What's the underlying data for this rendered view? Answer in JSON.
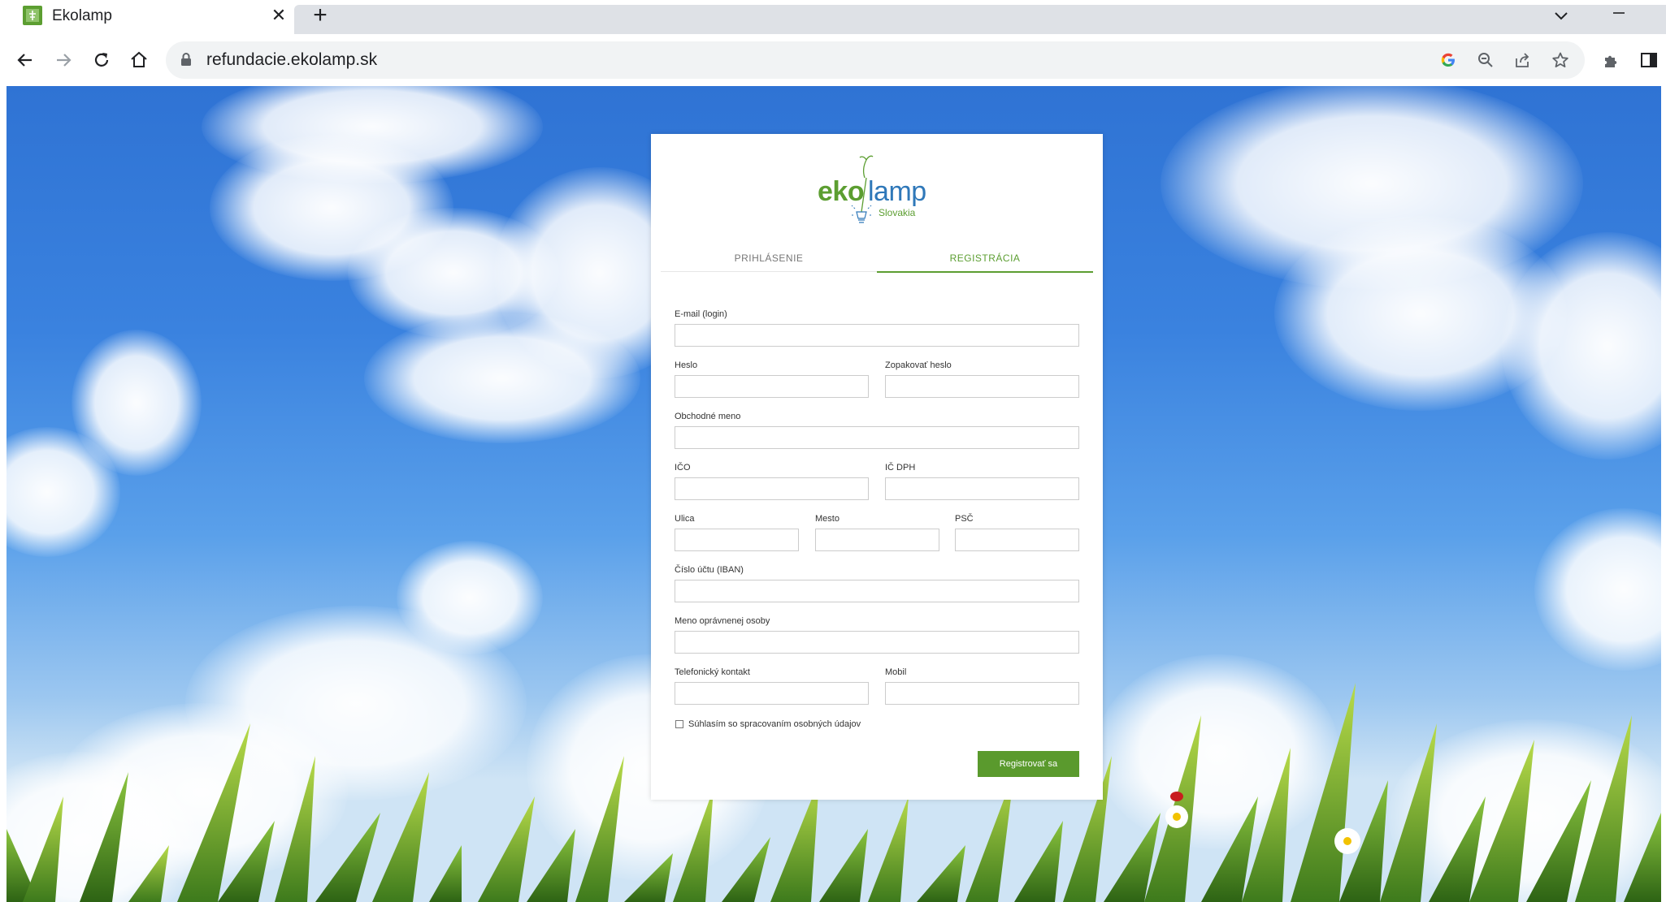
{
  "browser": {
    "tab_title": "Ekolamp",
    "tab_close": "✕",
    "new_tab": "+",
    "url": "refundacie.ekolamp.sk"
  },
  "icons": {
    "back": "arrow-left-icon",
    "forward": "arrow-right-icon",
    "reload": "reload-icon",
    "home": "home-icon",
    "lock": "lock-icon",
    "google": "google-icon",
    "zoom": "zoom-out-icon",
    "share": "share-icon",
    "bookmark": "star-icon",
    "extensions": "puzzle-icon",
    "sidepanel": "side-panel-icon"
  },
  "logo": {
    "eko": "eko",
    "lamp": "lamp",
    "sub": "Slovakia"
  },
  "tabs": {
    "login": "PRIHLÁSENIE",
    "register": "REGISTRÁCIA"
  },
  "form": {
    "email": {
      "label": "E-mail (login)",
      "value": ""
    },
    "password": {
      "label": "Heslo",
      "value": ""
    },
    "password_repeat": {
      "label": "Zopakovať heslo",
      "value": ""
    },
    "business_name": {
      "label": "Obchodné meno",
      "value": ""
    },
    "ico": {
      "label": "IČO",
      "value": ""
    },
    "ic_dph": {
      "label": "IČ DPH",
      "value": ""
    },
    "street": {
      "label": "Ulica",
      "value": ""
    },
    "city": {
      "label": "Mesto",
      "value": ""
    },
    "psc": {
      "label": "PSČ",
      "value": ""
    },
    "iban": {
      "label": "Číslo účtu (IBAN)",
      "value": ""
    },
    "authorized_person": {
      "label": "Meno oprávnenej osoby",
      "value": ""
    },
    "phone": {
      "label": "Telefonický kontakt",
      "value": ""
    },
    "mobile": {
      "label": "Mobil",
      "value": ""
    },
    "consent": {
      "label": "Súhlasím so spracovaním osobných údajov",
      "checked": false
    },
    "submit": "Registrovať sa"
  },
  "colors": {
    "brand_green": "#5c9e31",
    "brand_blue": "#2f78b9",
    "button_green": "#5a9a2d"
  }
}
